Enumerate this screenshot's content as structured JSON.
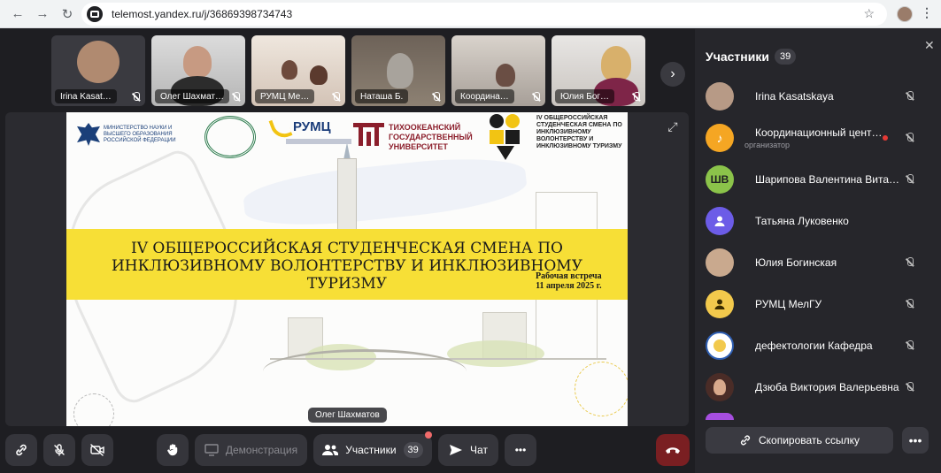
{
  "browser": {
    "url": "telemost.yandex.ru/j/36869398734743",
    "back_glyph": "←",
    "forward_glyph": "→",
    "reload_glyph": "↻",
    "star_glyph": "☆",
    "menu_glyph": "⋮"
  },
  "thumbnails": [
    {
      "name": "Irina Kasat…"
    },
    {
      "name": "Олег Шахмат…"
    },
    {
      "name": "РУМЦ Ме…"
    },
    {
      "name": "Наташа Б."
    },
    {
      "name": "Координа…"
    },
    {
      "name": "Юлия Бог…"
    }
  ],
  "next_glyph": "›",
  "expand_glyph": "⤢",
  "slide": {
    "ministry": "МИНИСТЕРСТВО НАУКИ И ВЫСШЕГО ОБРАЗОВАНИЯ РОССИЙСКОЙ ФЕДЕРАЦИИ",
    "rumc": "РУМЦ",
    "university": "ТИХООКЕАНСКИЙ ГОСУДАРСТВЕННЫЙ УНИВЕРСИТЕТ",
    "event_logo_text": "IV ОБЩЕРОССИЙСКАЯ СТУДЕНЧЕСКАЯ СМЕНА ПО ИНКЛЮЗИВНОМУ ВОЛОНТЕРСТВУ И ИНКЛЮЗИВНОМУ ТУРИЗМУ",
    "title_line1": "IV ОБЩЕРОССИЙСКАЯ СТУДЕНЧЕСКАЯ СМЕНА ПО",
    "title_line2": "ИНКЛЮЗИВНОМУ ВОЛОНТЕРСТВУ И ИНКЛЮЗИВНОМУ",
    "title_line3": "ТУРИЗМУ",
    "meeting_line1": "Рабочая встреча",
    "meeting_line2": "11 апреля 2025 г."
  },
  "speaker": "Олег Шахматов",
  "toolbar": {
    "demo_label": "Демонстрация",
    "participants_label": "Участники",
    "participants_count": "39",
    "chat_label": "Чат",
    "more_glyph": "•••"
  },
  "panel": {
    "title": "Участники",
    "count": "39",
    "close_glyph": "✕",
    "copy_label": "Скопировать ссылку",
    "more_glyph": "•••",
    "participants": [
      {
        "name": "Irina Kasatskaya",
        "sub": "",
        "initials": "",
        "color": "#b79a86",
        "muted": true
      },
      {
        "name": "Координационный цент…",
        "sub": "организатор",
        "initials": "",
        "color": "#f5a623",
        "muted": true
      },
      {
        "name": "Шарипова Валентина Вита…",
        "sub": "",
        "initials": "ШВ",
        "color": "#8bc34a",
        "muted": true
      },
      {
        "name": "Татьяна Луковенко",
        "sub": "",
        "initials": "",
        "color": "#6c5ce7",
        "muted": false
      },
      {
        "name": "Юлия Богинская",
        "sub": "",
        "initials": "",
        "color": "#c9a98e",
        "muted": true
      },
      {
        "name": "РУМЦ МелГУ",
        "sub": "",
        "initials": "",
        "color": "#f2c94c",
        "muted": true
      },
      {
        "name": "дефектологии Кафедра",
        "sub": "",
        "initials": "",
        "color": "#ffffff",
        "muted": true
      },
      {
        "name": "Дзюба Виктория Валерьевна",
        "sub": "",
        "initials": "",
        "color": "#4a2c27",
        "muted": true
      }
    ]
  }
}
